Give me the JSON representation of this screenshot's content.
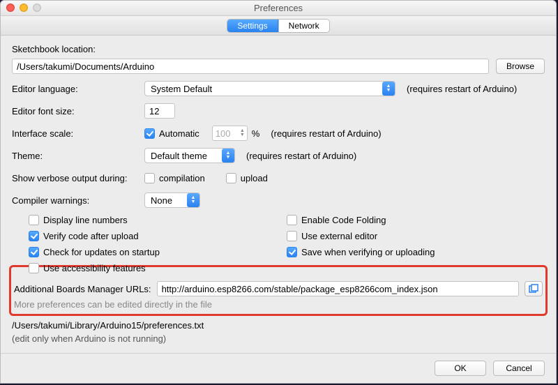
{
  "title": "Preferences",
  "tabs": {
    "settings": "Settings",
    "network": "Network"
  },
  "sketchbook": {
    "label": "Sketchbook location:",
    "path": "/Users/takumi/Documents/Arduino",
    "browse": "Browse"
  },
  "editorLanguage": {
    "label": "Editor language:",
    "value": "System Default",
    "note": "(requires restart of Arduino)"
  },
  "fontSize": {
    "label": "Editor font size:",
    "value": "12"
  },
  "interfaceScale": {
    "label": "Interface scale:",
    "auto": "Automatic",
    "autoChecked": true,
    "value": "100",
    "pct": "%",
    "note": "(requires restart of Arduino)"
  },
  "theme": {
    "label": "Theme:",
    "value": "Default theme",
    "note": "(requires restart of Arduino)"
  },
  "verbose": {
    "label": "Show verbose output during:",
    "compilation": "compilation",
    "compilationChecked": false,
    "upload": "upload",
    "uploadChecked": false
  },
  "warnings": {
    "label": "Compiler warnings:",
    "value": "None"
  },
  "checks": {
    "left": [
      {
        "label": "Display line numbers",
        "checked": false
      },
      {
        "label": "Verify code after upload",
        "checked": true
      },
      {
        "label": "Check for updates on startup",
        "checked": true
      },
      {
        "label": "Use accessibility features",
        "checked": false
      }
    ],
    "right": [
      {
        "label": "Enable Code Folding",
        "checked": false
      },
      {
        "label": "Use external editor",
        "checked": false
      },
      {
        "label": "Save when verifying or uploading",
        "checked": true
      }
    ]
  },
  "boardsUrl": {
    "label": "Additional Boards Manager URLs:",
    "value": "http://arduino.esp8266.com/stable/package_esp8266com_index.json"
  },
  "moreLine": "More preferences can be edited directly in the file",
  "prefsPath": "/Users/takumi/Library/Arduino15/preferences.txt",
  "editNote": "(edit only when Arduino is not running)",
  "buttons": {
    "ok": "OK",
    "cancel": "Cancel"
  }
}
